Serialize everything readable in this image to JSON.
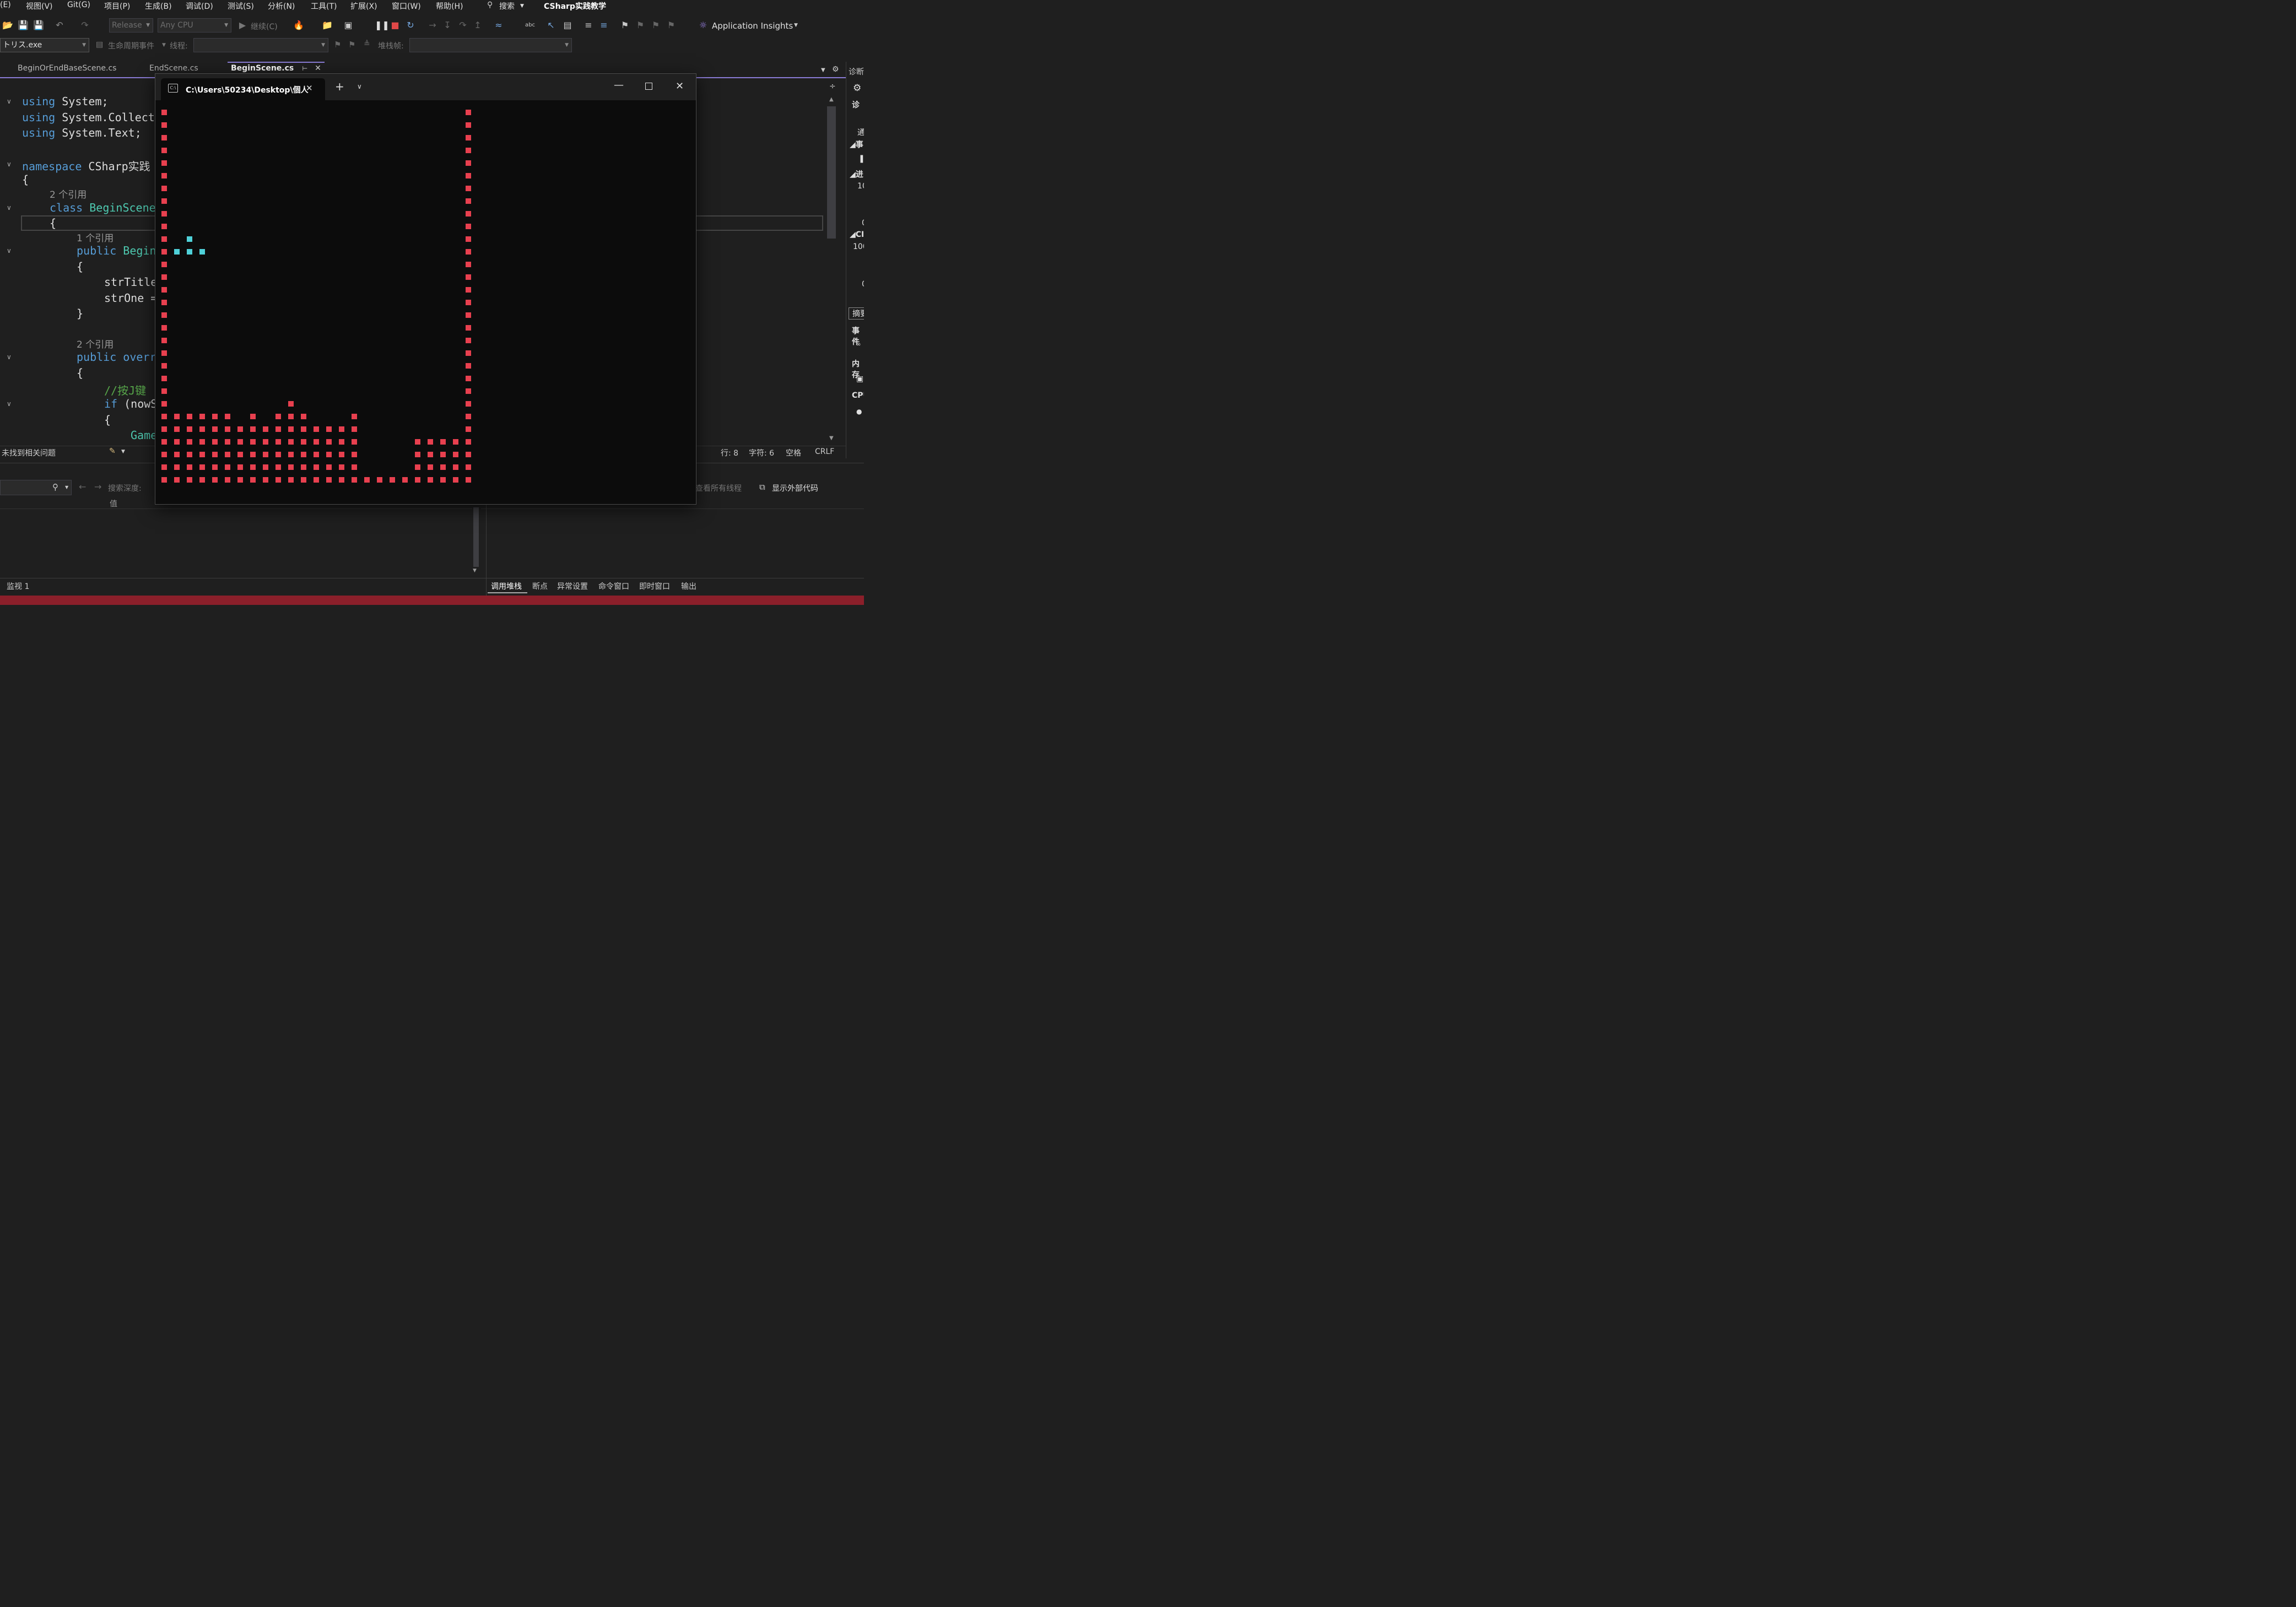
{
  "menu": [
    "(E)",
    "视图(V)",
    "Git(G)",
    "项目(P)",
    "生成(B)",
    "调试(D)",
    "测试(S)",
    "分析(N)",
    "工具(T)",
    "扩展(X)",
    "窗口(W)",
    "帮助(H)"
  ],
  "search_label": "搜索",
  "solution_title": "CSharp实践教学",
  "toolbar": {
    "config": "Release",
    "platform": "Any CPU",
    "continue_label": "继续(C)",
    "app_insights": "Application Insights"
  },
  "toolbar2": {
    "process": "トリス.exe",
    "lifecycle": "生命周期事件",
    "thread_label": "线程:",
    "stackframe_label": "堆栈帧:"
  },
  "tabs": [
    {
      "label": "BeginOrEndBaseScene.cs"
    },
    {
      "label": "EndScene.cs"
    },
    {
      "label": "BeginScene.cs"
    }
  ],
  "right_panel_title": "诊断",
  "right_panel": {
    "diag": "诊",
    "general": "通",
    "events": "事",
    "process": "进",
    "process_val": "10",
    "zero": "0",
    "cpu": "CI",
    "cpu_val": "100",
    "summary": "摘要",
    "events2": "事件",
    "memory": "内存",
    "cpu_label": "CPU"
  },
  "code": {
    "l1_kw": "using",
    "l1_rest": " System;",
    "l2_kw": "using",
    "l2_rest": " System.Collect",
    "l3_kw": "using",
    "l3_rest": " System.Text;",
    "l4_kw": "namespace",
    "l4_rest": " CSharp实践",
    "brace_open": "{",
    "brace_close": "}",
    "ref2": "2 个引用",
    "l6_kw": "class",
    "l6_cls": " BeginScene",
    "ref1": "1 个引用",
    "l8_kw": "public",
    "l8_rest": " Begin",
    "l9": "strTitle",
    "l10": "strOne =",
    "ref2b": "2 个引用",
    "l12_kw": "public",
    "l12_kw2": " overr",
    "comment": "//按J键",
    "l14_kw": "if",
    "l14_rest": " (nowS",
    "l15": "Game"
  },
  "status": {
    "issues": "未找到相关问题",
    "line": "行: 8",
    "char": "字符: 6",
    "space": "空格",
    "eol": "CRLF"
  },
  "bottom": {
    "search_depth": "搜索深度:",
    "value_col": "值",
    "watch": "监视 1",
    "show_all_threads": "查看所有线程",
    "show_external": "显示外部代码",
    "tabs": [
      "调用堆栈",
      "断点",
      "异常设置",
      "命令窗口",
      "即时窗口",
      "输出"
    ]
  },
  "console": {
    "title": "C:\\Users\\50234\\Desktop\\個人",
    "colors": {
      "wall": "#e8404f",
      "piece": "#4fd1d9"
    }
  },
  "colors": {
    "accent": "#8a7bd4",
    "statusbar_accent": "#8b1f2a"
  }
}
